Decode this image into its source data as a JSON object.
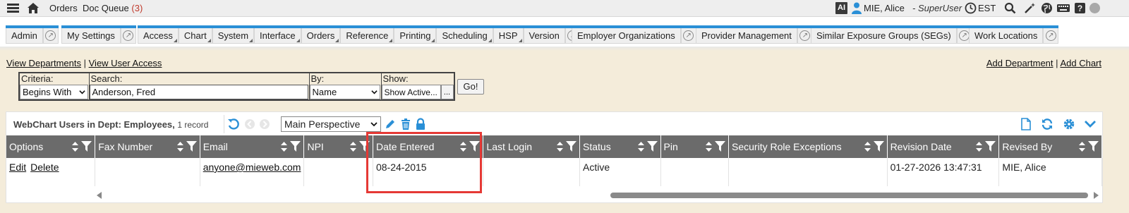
{
  "topbar": {
    "orders": "Orders",
    "doc_queue": "Doc Queue",
    "doc_queue_count": "(3)",
    "ai_label": "AI",
    "user_name": "MIE, Alice",
    "role": "- SuperUser",
    "timezone": "EST",
    "icons": [
      "hamburger-icon",
      "home-icon",
      "ai-icon",
      "user-icon",
      "clock-icon",
      "search-icon",
      "magic-wand-icon",
      "globe-icon",
      "keyboard-icon",
      "help-icon",
      "status-icon"
    ]
  },
  "tabs": {
    "groups": [
      {
        "items": [
          {
            "label": "Admin"
          }
        ],
        "ext": true
      },
      {
        "items": [
          {
            "label": "My Settings"
          }
        ],
        "ext": true
      },
      {
        "items": [
          {
            "label": "Access",
            "menu": true
          },
          {
            "label": "Chart",
            "menu": true
          },
          {
            "label": "System",
            "menu": true
          },
          {
            "label": "Interface",
            "menu": true
          },
          {
            "label": "Orders",
            "menu": true
          },
          {
            "label": "Reference",
            "menu": true
          },
          {
            "label": "Printing",
            "menu": true
          },
          {
            "label": "Scheduling",
            "menu": true
          },
          {
            "label": "HSP",
            "menu": true
          },
          {
            "label": "Version"
          }
        ],
        "ext": true
      },
      {
        "items": [
          {
            "label": "Employer Organizations"
          }
        ],
        "ext": true
      },
      {
        "items": [
          {
            "label": "Provider Management"
          }
        ],
        "ext": true
      },
      {
        "items": [
          {
            "label": "Similar Exposure Groups (SEGs)"
          }
        ],
        "ext": true
      },
      {
        "items": [
          {
            "label": "Work Locations"
          }
        ],
        "ext": true
      }
    ],
    "accent": "#2a8fd6"
  },
  "links": {
    "view_departments": "View Departments",
    "view_user_access": "View User Access",
    "add_department": "Add Department",
    "add_chart": "Add Chart",
    "separator": "|"
  },
  "search": {
    "criteria_label": "Criteria:",
    "criteria_value": "Begins With",
    "search_label": "Search:",
    "search_value": "Anderson, Fred",
    "by_label": "By:",
    "by_value": "Name",
    "show_label": "Show:",
    "show_value": "Show Active...",
    "show_more": "...",
    "go": "Go!"
  },
  "grid": {
    "title": "WebChart Users in Dept: Employees,",
    "record_count": "1 record",
    "perspective": "Main Perspective",
    "columns": [
      "Options",
      "Fax Number",
      "Email",
      "NPI",
      "Date Entered",
      "Last Login",
      "Status",
      "Pin",
      "Security Role Exceptions",
      "Revision Date",
      "Revised By"
    ],
    "rows": [
      {
        "options": [
          "Edit",
          "Delete"
        ],
        "fax": "",
        "email": "anyone@mieweb.com",
        "npi": "",
        "date_entered": "08-24-2015",
        "last_login": "",
        "status": "Active",
        "pin": "",
        "security_role_exceptions": "",
        "revision_date": "01-27-2026 13:47:31",
        "revised_by": "MIE, Alice"
      }
    ],
    "header_color": "#6b6b6b",
    "icon_color": "#2a8fd6"
  }
}
